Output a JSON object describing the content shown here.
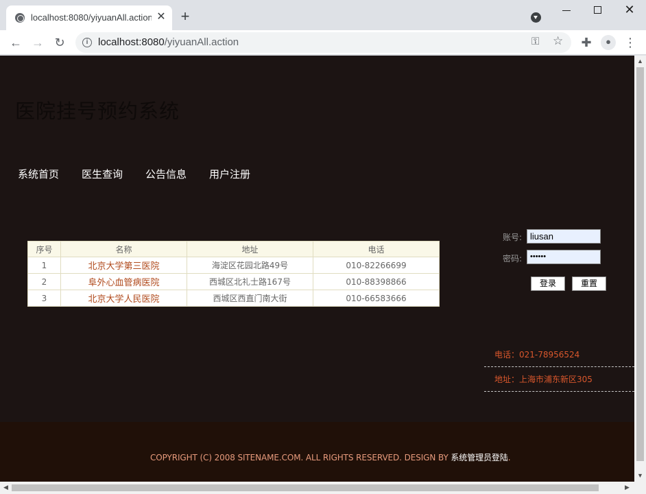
{
  "browser": {
    "tab_title": "localhost:8080/yiyuanAll.action",
    "url_host": "localhost:8080",
    "url_path": "/yiyuanAll.action"
  },
  "site": {
    "title": "医院挂号预约系统",
    "nav": [
      "系统首页",
      "医生查询",
      "公告信息",
      "用户注册"
    ]
  },
  "table": {
    "headers": [
      "序号",
      "名称",
      "地址",
      "电话"
    ],
    "rows": [
      {
        "no": "1",
        "name": "北京大学第三医院",
        "address": "海淀区花园北路49号",
        "phone": "010-82266699"
      },
      {
        "no": "2",
        "name": "阜外心血管病医院",
        "address": "西城区北礼士路167号",
        "phone": "010-88398866"
      },
      {
        "no": "3",
        "name": "北京大学人民医院",
        "address": "西城区西直门南大街",
        "phone": "010-66583666"
      }
    ]
  },
  "login": {
    "account_label": "账号:",
    "account_value": "liusan",
    "password_label": "密码:",
    "password_value": "••••••",
    "login_button": "登录",
    "reset_button": "重置"
  },
  "contact": {
    "phone": "电话：021-78956524",
    "address": "地址：上海市浦东新区305"
  },
  "footer": {
    "copyright": "COPYRIGHT (C) 2008 SITENAME.COM. ALL RIGHTS RESERVED. DESIGN BY ",
    "admin_link": "系统管理员登陆",
    "period": "."
  },
  "colors": {
    "page_bg": "#1c1413",
    "footer_bg": "#201008",
    "link_red": "#b04a1c",
    "contact_orange": "#d9572c"
  }
}
